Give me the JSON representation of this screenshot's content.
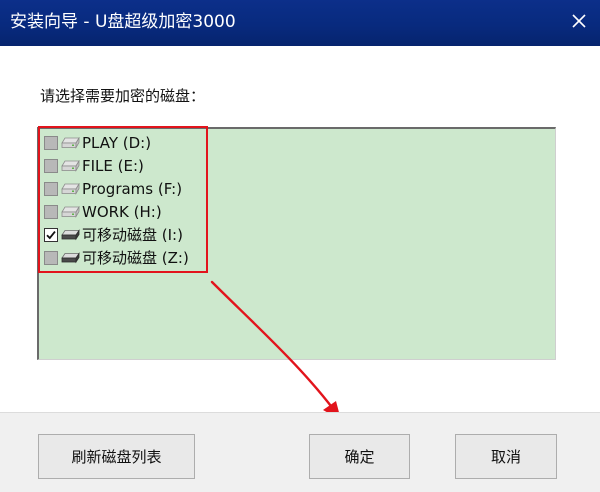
{
  "window": {
    "title": "安装向导 - U盘超级加密3000"
  },
  "main": {
    "prompt": "请选择需要加密的磁盘："
  },
  "disks": [
    {
      "label": "PLAY (D:)",
      "checked": false,
      "icon": "hard-drive-icon"
    },
    {
      "label": "FILE (E:)",
      "checked": false,
      "icon": "hard-drive-icon"
    },
    {
      "label": "Programs (F:)",
      "checked": false,
      "icon": "hard-drive-icon"
    },
    {
      "label": "WORK (H:)",
      "checked": false,
      "icon": "hard-drive-icon"
    },
    {
      "label": "可移动磁盘 (I:)",
      "checked": true,
      "icon": "removable-drive-icon"
    },
    {
      "label": "可移动磁盘 (Z:)",
      "checked": false,
      "icon": "removable-drive-icon"
    }
  ],
  "footer": {
    "refresh_label": "刷新磁盘列表",
    "ok_label": "确定",
    "cancel_label": "取消"
  },
  "colors": {
    "titlebar": "#082a7e",
    "list_background": "#cde8cd",
    "annotation": "#e2141c"
  }
}
